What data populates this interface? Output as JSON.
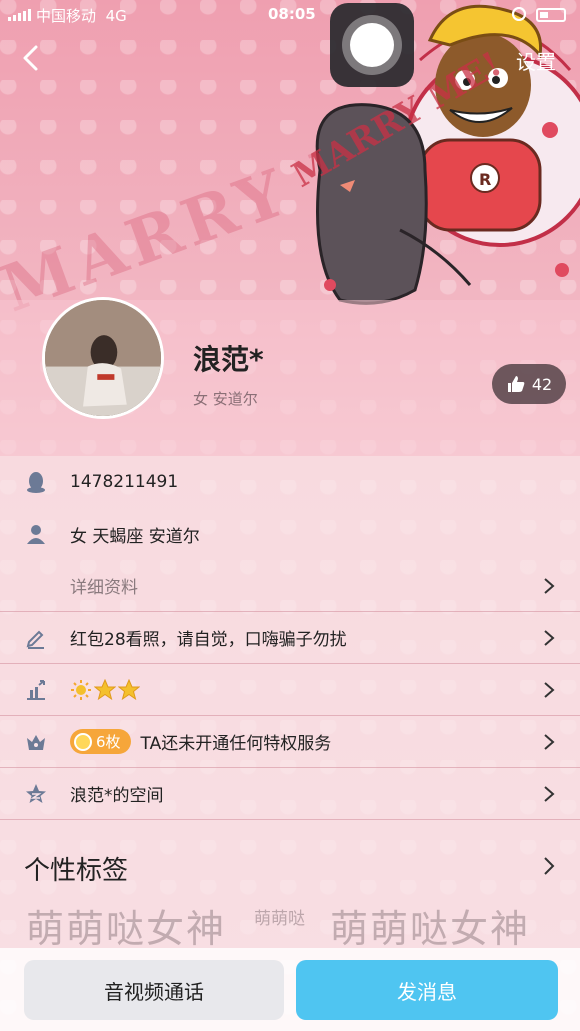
{
  "status_bar": {
    "carrier": "中国移动",
    "network": "4G",
    "time": "08:05"
  },
  "header": {
    "settings_label": "设置",
    "background_text": "MARRY ME!",
    "sticker_text": "MARRY ME!"
  },
  "profile": {
    "nickname": "浪范*",
    "subinfo": "女  安道尔",
    "likes": "42"
  },
  "info_rows": {
    "qq_number": "1478211491",
    "basic": "女 天蝎座 安道尔",
    "details_link": "详细资料",
    "signature": "红包28看照，请自觉，口嗨骗子勿扰",
    "privilege_badge": "6枚",
    "privilege_text": "TA还未开通任何特权服务",
    "space": "浪范*的空间"
  },
  "tags": {
    "title": "个性标签",
    "tag_left": "萌萌哒女神",
    "tag_mid": "萌萌哒",
    "tag_right": "萌萌哒女神"
  },
  "actions": {
    "call_label": "音视频通话",
    "message_label": "发消息"
  },
  "colors": {
    "accent": "#4fc5f1",
    "badge": "#f6a63a",
    "star": "#f4c02d"
  }
}
